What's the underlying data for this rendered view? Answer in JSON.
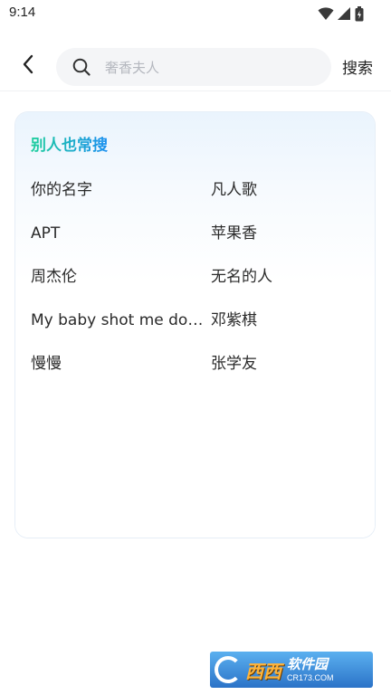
{
  "status_bar": {
    "time": "9:14",
    "icons": [
      "wifi-icon",
      "signal-icon",
      "battery-icon"
    ]
  },
  "search": {
    "placeholder": "奢香夫人",
    "value": "",
    "submit_label": "搜索"
  },
  "popular": {
    "title": "别人也常搜",
    "title_gradient": [
      "#1fcf9d",
      "#1a8ff0"
    ],
    "items": [
      "你的名字",
      "凡人歌",
      "APT",
      "苹果香",
      "周杰伦",
      "无名的人",
      "My baby shot me down",
      "邓紫棋",
      "慢慢",
      "张学友"
    ]
  },
  "watermark": {
    "brand": "西西",
    "site": "软件园",
    "url": "CR173.COM"
  }
}
